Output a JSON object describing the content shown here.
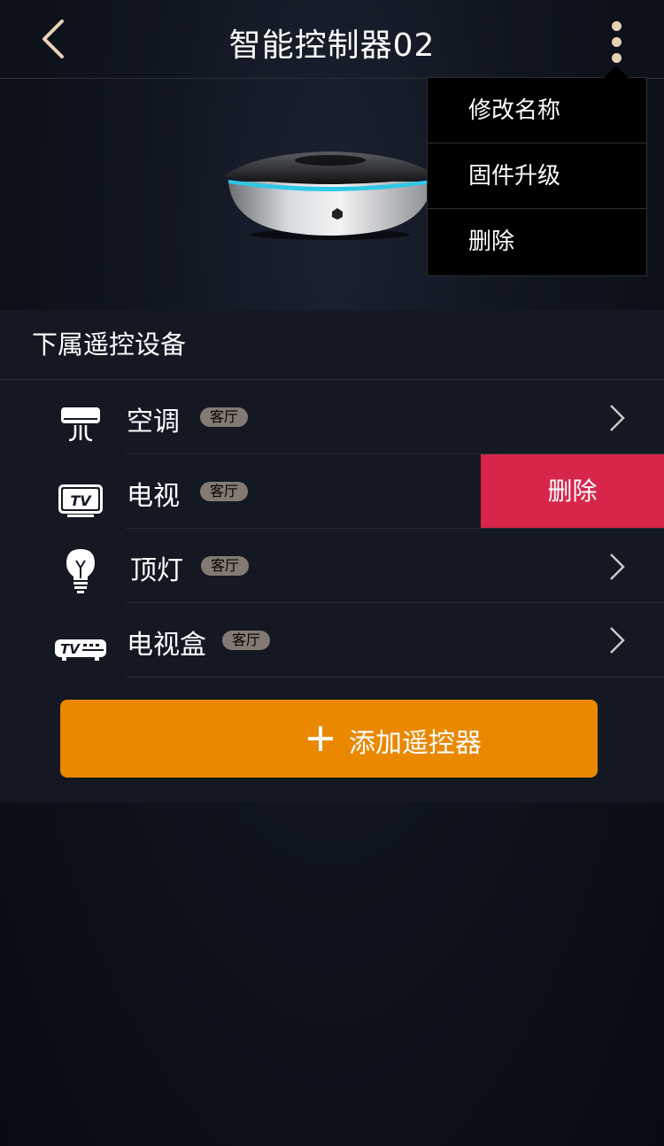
{
  "header": {
    "title": "智能控制器02",
    "back_icon": "chevron-left-icon",
    "more_icon": "more-vertical-icon"
  },
  "menu": {
    "items": [
      {
        "label": "修改名称"
      },
      {
        "label": "固件升级"
      },
      {
        "label": "删除"
      }
    ]
  },
  "section": {
    "title": "下属遥控设备"
  },
  "devices": [
    {
      "name": "空调",
      "room": "客厅",
      "icon": "air-conditioner-icon"
    },
    {
      "name": "电视",
      "room": "客厅",
      "icon": "tv-icon"
    },
    {
      "name": "顶灯",
      "room": "客厅",
      "icon": "lightbulb-icon"
    },
    {
      "name": "电视盒",
      "room": "客厅",
      "icon": "tv-box-icon"
    }
  ],
  "row_delete_label": "删除",
  "add_button": {
    "label": "添加遥控器"
  },
  "colors": {
    "accent": "#ea8800",
    "delete": "#d8264a",
    "badge": "#837a73",
    "icon_back": "#e6d2b6"
  }
}
